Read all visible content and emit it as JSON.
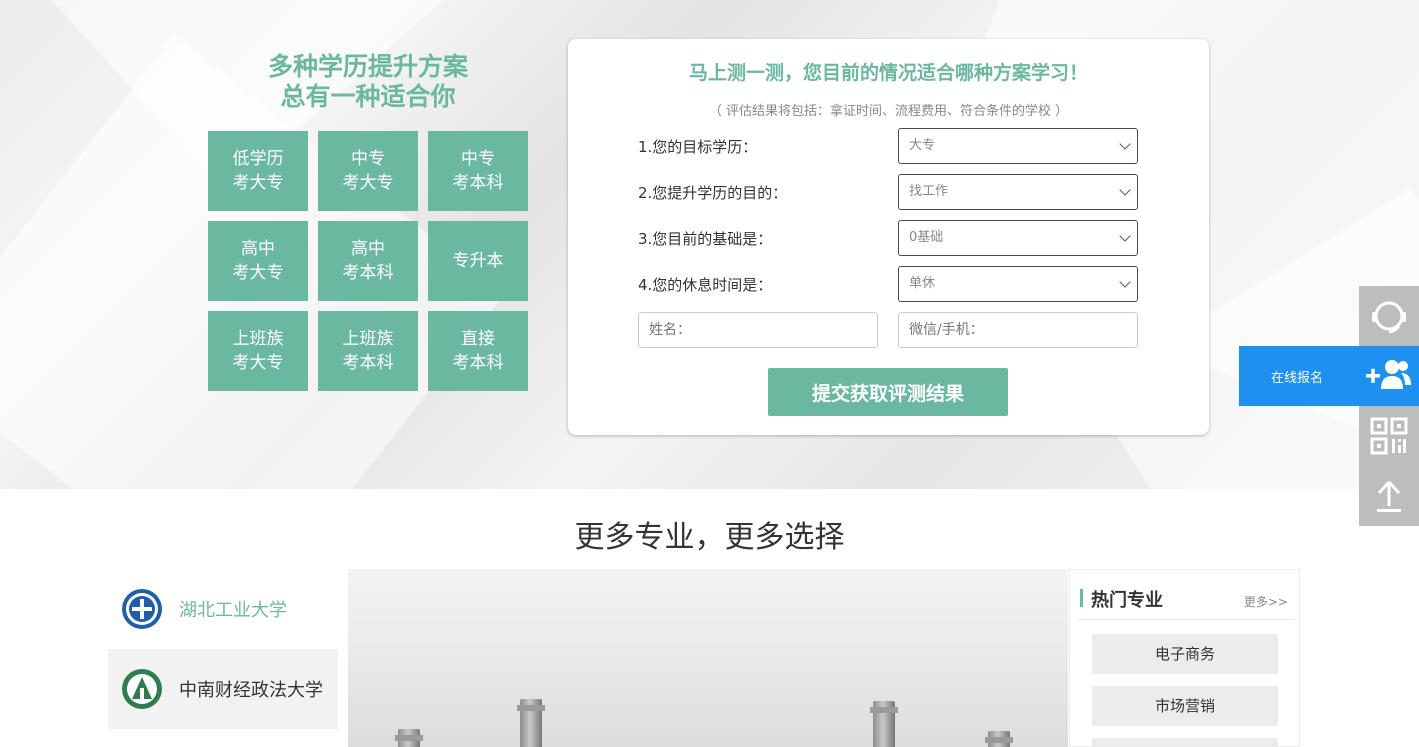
{
  "hero": {
    "title_line1": "多种学历提升方案",
    "title_line2": "总有一种适合你",
    "tiles": [
      "低学历\n考大专",
      "中专\n考大专",
      "中专\n考本科",
      "高中\n考大专",
      "高中\n考本科",
      "专升本",
      "上班族\n考大专",
      "上班族\n考本科",
      "直接\n考本科"
    ]
  },
  "form": {
    "title": "马上测一测，您目前的情况适合哪种方案学习！",
    "subtitle": "（ 评估结果将包括：拿证时间、流程费用、符合条件的学校 ）",
    "questions": [
      {
        "label": "1.您的目标学历：",
        "value": "大专"
      },
      {
        "label": "2.您提升学历的目的：",
        "value": "找工作"
      },
      {
        "label": "3.您目前的基础是：",
        "value": "0基础"
      },
      {
        "label": "4.您的休息时间是：",
        "value": "单休"
      }
    ],
    "name_placeholder": "姓名：",
    "contact_placeholder": "微信/手机：",
    "submit_label": "提交获取评测结果"
  },
  "side": {
    "apply_label": "在线报名",
    "icons": [
      "headset-icon",
      "add-user-icon",
      "qr-code-icon",
      "back-to-top-icon"
    ]
  },
  "section": {
    "title": "更多专业，更多选择",
    "universities": [
      "湖北工业大学",
      "中南财经政法大学"
    ],
    "hot": {
      "title": "热门专业",
      "more": "更多>>",
      "majors": [
        "电子商务",
        "市场营销"
      ]
    }
  },
  "colors": {
    "accent": "#6bb8a0",
    "apply_blue": "#1e90f0",
    "side_gray": "#bdbdbd"
  }
}
